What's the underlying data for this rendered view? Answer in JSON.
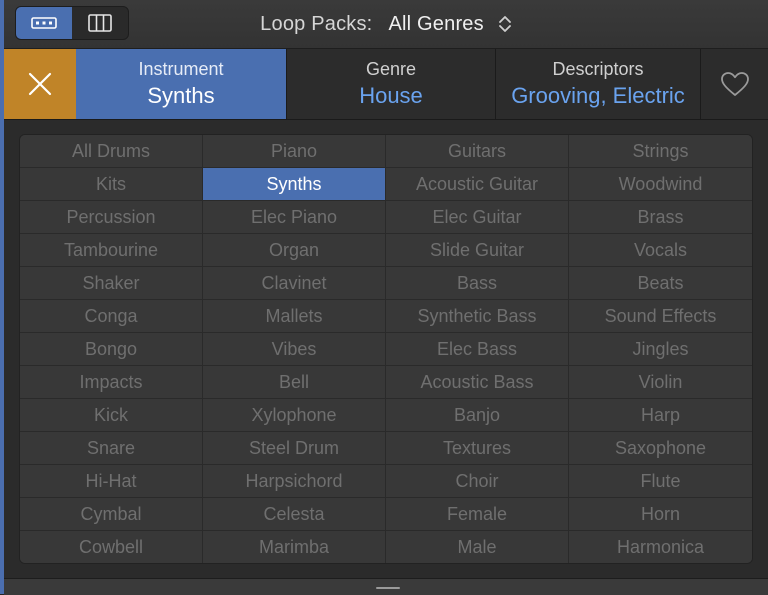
{
  "topbar": {
    "title_label": "Loop Packs:",
    "title_value": "All Genres",
    "view_modes": [
      "button-view",
      "column-view"
    ],
    "active_view": "button-view"
  },
  "filters": {
    "instrument": {
      "title": "Instrument",
      "value": "Synths"
    },
    "genre": {
      "title": "Genre",
      "value": "House"
    },
    "descriptors": {
      "title": "Descriptors",
      "value": "Grooving, Electric"
    }
  },
  "colors": {
    "accent": "#4a6fb0",
    "close_button": "#c08428",
    "link_value": "#6aa3ef"
  },
  "grid": {
    "selected": "Synths",
    "cells": [
      "All Drums",
      "Piano",
      "Guitars",
      "Strings",
      "Kits",
      "Synths",
      "Acoustic Guitar",
      "Woodwind",
      "Percussion",
      "Elec Piano",
      "Elec Guitar",
      "Brass",
      "Tambourine",
      "Organ",
      "Slide Guitar",
      "Vocals",
      "Shaker",
      "Clavinet",
      "Bass",
      "Beats",
      "Conga",
      "Mallets",
      "Synthetic Bass",
      "Sound Effects",
      "Bongo",
      "Vibes",
      "Elec Bass",
      "Jingles",
      "Impacts",
      "Bell",
      "Acoustic Bass",
      "Violin",
      "Kick",
      "Xylophone",
      "Banjo",
      "Harp",
      "Snare",
      "Steel Drum",
      "Textures",
      "Saxophone",
      "Hi-Hat",
      "Harpsichord",
      "Choir",
      "Flute",
      "Cymbal",
      "Celesta",
      "Female",
      "Horn",
      "Cowbell",
      "Marimba",
      "Male",
      "Harmonica"
    ]
  }
}
